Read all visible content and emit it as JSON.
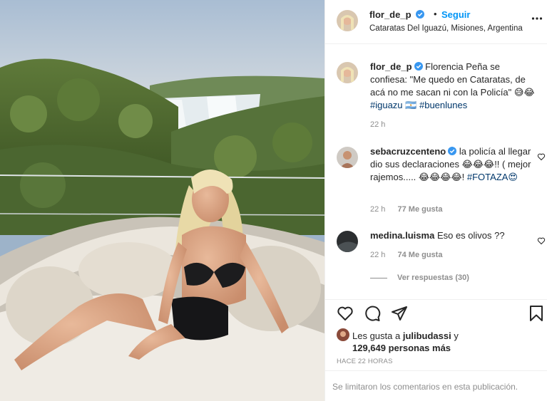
{
  "post": {
    "username": "flor_de_p",
    "follow_label": "Seguir",
    "separator": "•",
    "location": "Cataratas Del Iguazú, Misiones, Argentina",
    "more_icon": "more-horizontal-icon"
  },
  "caption": {
    "username": "flor_de_p",
    "text": "Florencia Peña se confiesa: \"Me quedo en Cataratas, de acá no me sacan ni con la Policía\" 😅😂",
    "hashtag1": "#iguazu",
    "flag": "🇦🇷",
    "hashtag2": "#buenlunes",
    "time": "22 h"
  },
  "comments": [
    {
      "username": "sebacruzcenteno",
      "text": " la policía al llegar dio sus declaraciones 😂😂😂!! ( mejor rajemos..... 😂😂😂😂! ",
      "hashtag": "#FOTAZA😍",
      "time": "22 h",
      "likes": "77 Me gusta"
    },
    {
      "username": "medina.luisma",
      "text": "Eso es olivos ??",
      "time": "22 h",
      "likes": "74 Me gusta"
    }
  ],
  "view_replies": "Ver respuestas (30)",
  "actions": {
    "icons": [
      "heart-icon",
      "comment-icon",
      "share-icon",
      "bookmark-icon"
    ]
  },
  "likes_summary": {
    "prefix": "Les gusta a ",
    "user": "julibudassi",
    "middle": " y",
    "count": "129,649 personas más"
  },
  "timestamp": "HACE 22 HORAS",
  "comments_limited": "Se limitaron los comentarios en esta publicación.",
  "colors": {
    "accent": "#0095f6",
    "verified": "#3897f0",
    "hashtag": "#00376b",
    "muted": "#8e8e8e"
  }
}
